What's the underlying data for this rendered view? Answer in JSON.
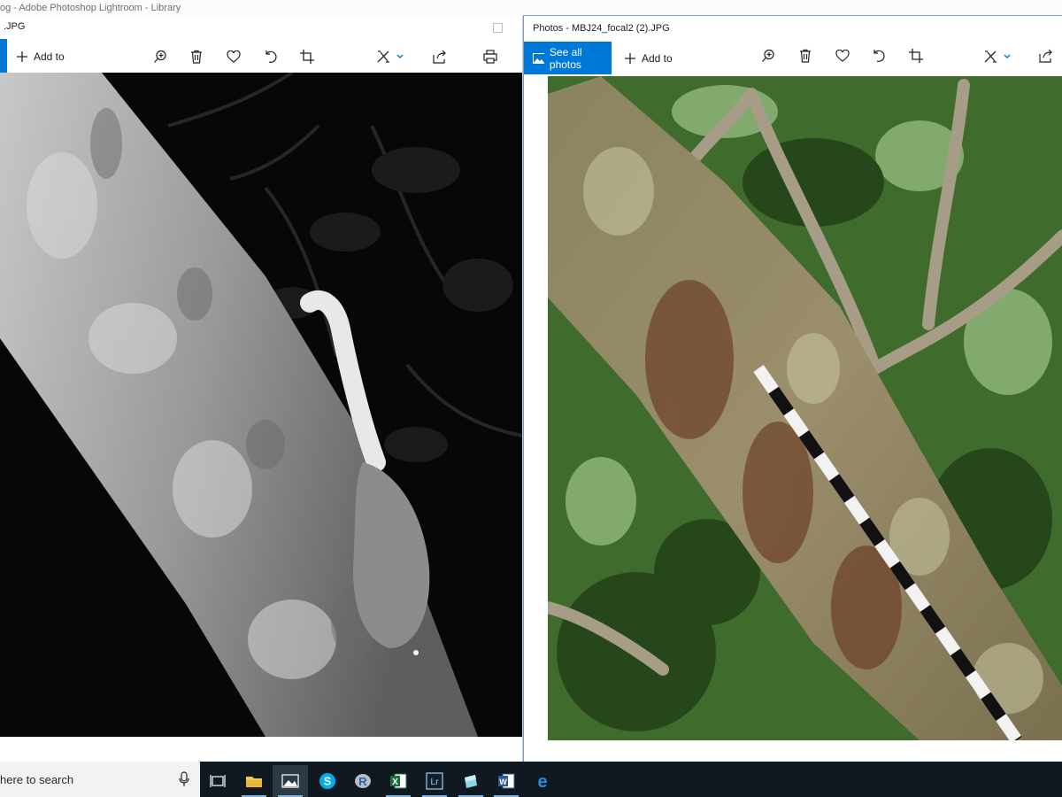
{
  "background_window": {
    "title": "og - Adobe Photoshop Lightroom - Library"
  },
  "left_window": {
    "title": ".JPG",
    "add_to_label": "Add to",
    "toolbar_icons": [
      "zoom-in-icon",
      "delete-icon",
      "heart-icon",
      "rotate-icon",
      "crop-icon",
      "edit-create-icon",
      "share-icon",
      "print-icon"
    ]
  },
  "right_window": {
    "title": "Photos - MBJ24_focal2 (2).JPG",
    "see_all_photos_label": "See all photos",
    "add_to_label": "Add to",
    "toolbar_icons": [
      "zoom-in-icon",
      "delete-icon",
      "heart-icon",
      "rotate-icon",
      "crop-icon",
      "edit-create-icon",
      "share-icon"
    ]
  },
  "taskbar": {
    "search_placeholder": "here to search",
    "apps": [
      "task-view-icon",
      "file-explorer-icon",
      "photos-icon",
      "skype-icon",
      "r-icon",
      "excel-icon",
      "lightroom-icon",
      "app-icon",
      "word-icon",
      "edge-icon"
    ],
    "lightroom_label": "Lr",
    "skype_label": "S",
    "r_label": "R",
    "excel_label": "X",
    "word_label": "W",
    "edge_label": "e"
  },
  "colors": {
    "accent": "#0078d7",
    "taskbar": "#101820",
    "excel": "#1d6f42",
    "word": "#2b579a",
    "skype": "#00aff0",
    "r": "#2466b5",
    "edge": "#1e8fe0"
  }
}
